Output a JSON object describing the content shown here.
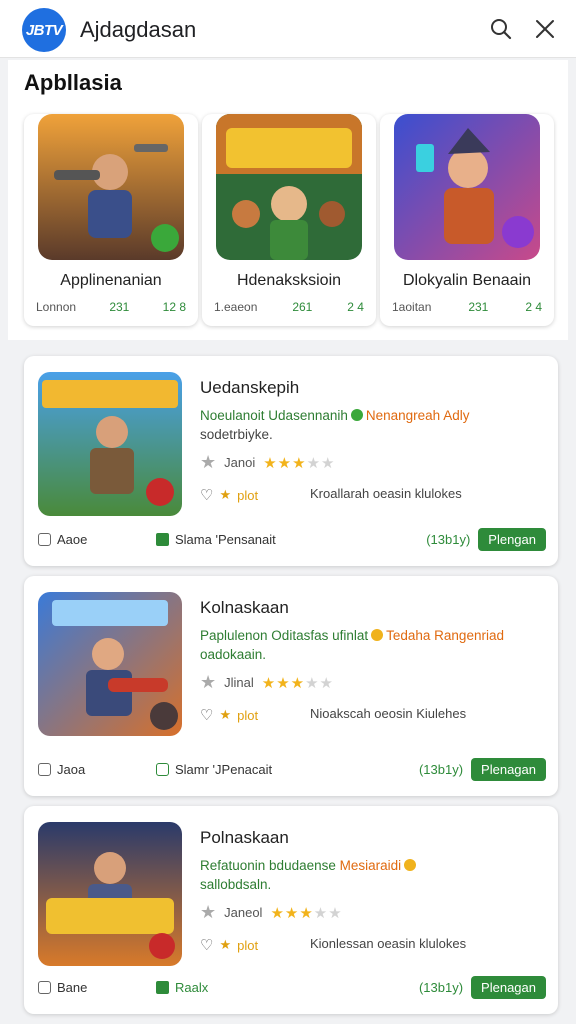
{
  "header": {
    "logo_text": "JBTV",
    "title": "Ajdagdasan"
  },
  "section": {
    "title": "Apbllasia",
    "cards": [
      {
        "name": "Applinenanian",
        "meta_left": "Lonnon",
        "meta_mid": "231",
        "meta_right": "12 8"
      },
      {
        "name": "Hdenaksksioin",
        "meta_left": "1.eaeon",
        "meta_mid": "261",
        "meta_right": "2 4"
      },
      {
        "name": "Dlokyalin Benaain",
        "meta_left": "1aoitan",
        "meta_mid": "231",
        "meta_right": "2 4"
      }
    ]
  },
  "rows": [
    {
      "title": "Uedanskepih",
      "desc_green": "Noeulanoit Udasennanih",
      "desc_orange": "Nenangreah Adly",
      "desc_line2": "sodetrbiyke.",
      "dot_color": "#3aa83a",
      "rate_label": "Janoi",
      "plot": "plot",
      "extra": "Kroallarah oeasin klulokes",
      "tag": "Aaoe",
      "status": "Slama 'Pensanait",
      "count": "(13b1y)",
      "button": "Plengan"
    },
    {
      "title": "Kolnaskaan",
      "desc_green": "Paplulenon Oditasfas ufinlat",
      "desc_orange": "Tedaha Rangenriad",
      "desc_line2": "oadokaain.",
      "dot_color": "#f0b21c",
      "rate_label": "Jlinal",
      "plot": "plot",
      "extra": "Nioakscah oeosin Kiulehes",
      "tag": "Jaoa",
      "status": "Slamr 'JPenacait",
      "count": "(13b1y)",
      "button": "Plenagan"
    },
    {
      "title": "Polnaskaan",
      "desc_green": "Refatuonin bdudaense",
      "desc_orange": "Mesiaraidi",
      "desc_line2": "sallobdsaln.",
      "dot_color": "#f0b21c",
      "rate_label": "Janeol",
      "plot": "plot",
      "extra": "Kionlessan oeasin klulokes",
      "tag": "Bane",
      "status": "Raalx",
      "count": "(13b1y)",
      "button": "Plenagan"
    }
  ]
}
